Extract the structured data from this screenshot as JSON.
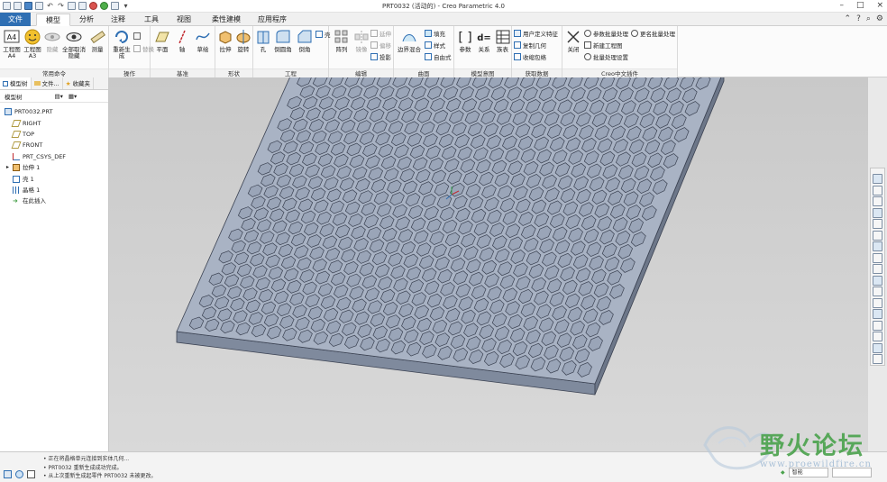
{
  "window": {
    "title": "PRT0032 (活动的) - Creo Parametric 4.0",
    "controls": [
      "–",
      "□",
      "×"
    ]
  },
  "tabs": [
    {
      "label": "文件"
    },
    {
      "label": "模型"
    },
    {
      "label": "分析"
    },
    {
      "label": "注释"
    },
    {
      "label": "工具"
    },
    {
      "label": "视图"
    },
    {
      "label": "柔性建模"
    },
    {
      "label": "应用程序"
    }
  ],
  "ribbon": {
    "groups": {
      "common": "常用命令",
      "operations": "操作",
      "datum": "基准",
      "shape": "形状",
      "engineering": "工程",
      "editing": "编辑",
      "surfaces": "曲面",
      "intent": "模型意图",
      "getdata": "获取数据",
      "creo_cn": "Creo中文插件"
    },
    "buttons": {
      "drawing_a4_1": "工程图",
      "drawing_a4_2": "A4",
      "drawing_a3_1": "工程图",
      "drawing_a3_2": "A3",
      "hide": "隐藏",
      "unhide_all_1": "全部取消",
      "unhide_all_2": "隐藏",
      "measure": "测量",
      "regenerate": "重新生成",
      "replace": "替换",
      "plane": "平面",
      "axis": "轴",
      "sketch": "草绘",
      "extrude": "拉伸",
      "revolve": "旋转",
      "hole": "孔",
      "round": "倒圆角",
      "chamfer": "倒角",
      "shell": "壳",
      "pattern": "阵列",
      "mirror": "镜像",
      "extend": "延伸",
      "offset": "偏移",
      "project": "投影",
      "boundary_blend": "边界混合",
      "fill": "填充",
      "style": "样式",
      "freestyle": "自由式",
      "params": "参数",
      "relations": "关系",
      "family_table": "族表",
      "udf": "用户定义特征",
      "copy_geom": "复制几何",
      "shrinkwrap": "收缩包络",
      "close": "关闭",
      "param_batch": "参数批量处理",
      "new_drawing": "新建工程图",
      "batch_settings": "批量处理设置",
      "rename_batch": "更名批量处理"
    }
  },
  "left_panel": {
    "tabs": [
      "模型树",
      "文件...",
      "收藏夹"
    ],
    "toolbar_label": "模型树",
    "tree": [
      {
        "label": "PRT0032.PRT",
        "indent": 0
      },
      {
        "label": "RIGHT",
        "indent": 1
      },
      {
        "label": "TOP",
        "indent": 1
      },
      {
        "label": "FRONT",
        "indent": 1
      },
      {
        "label": "PRT_CSYS_DEF",
        "indent": 1
      },
      {
        "label": "拉伸 1",
        "indent": 1
      },
      {
        "label": "壳 1",
        "indent": 1
      },
      {
        "label": "晶格 1",
        "indent": 1
      },
      {
        "label": "在此插入",
        "indent": 1
      }
    ]
  },
  "status": {
    "messages": [
      "• 正在将晶格单元连接到实体几何...",
      "• PRT0032 重新生成成功完成。",
      "• 从上次重新生成起零件 PRT0032 未被更改。"
    ],
    "smart_field": "智能",
    "filter_field": "",
    "watermark_title": "野火论坛",
    "watermark_url": "www.proewildfire.cn"
  },
  "colors": {
    "accent": "#2f6fb3",
    "model_face": "#9aa5b8",
    "model_edge": "#3b4252",
    "viewport_bg": "#cfcfcf"
  }
}
